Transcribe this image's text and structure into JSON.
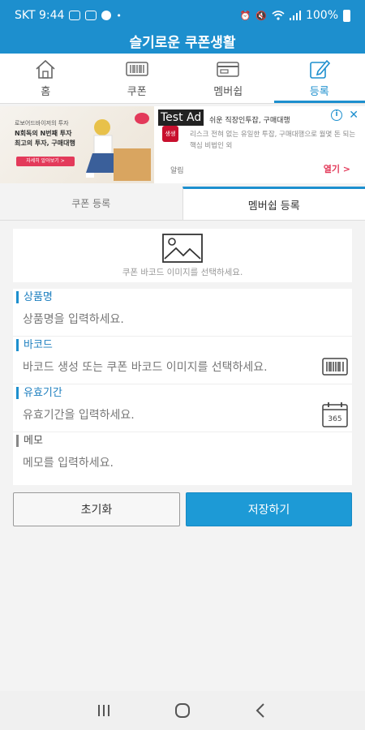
{
  "status_bar": {
    "carrier_time": "SKT 9:44",
    "battery": "100%"
  },
  "app": {
    "title": "슬기로운 쿠폰생활"
  },
  "top_tabs": [
    {
      "label": "홈",
      "icon": "home-icon"
    },
    {
      "label": "쿠폰",
      "icon": "barcode-icon"
    },
    {
      "label": "멤버쉽",
      "icon": "card-icon"
    },
    {
      "label": "등록",
      "icon": "edit-icon",
      "active": true
    }
  ],
  "ad": {
    "image_line1": "로보어드바이저의 투자",
    "image_line2": "N회독의 N번째 투자",
    "image_line3": "최고의 투자, 구매대행",
    "image_button": "자세히 알아보기 >",
    "badge": "Test Ad",
    "logo_text": "생생",
    "headline": "쉬운 직장인투잡, 구매대행",
    "description": "리스크 전혀 없는 유일한 투잡, 구매대행으로 월몇 돈 되는 핵심 비법인 외",
    "sponsor": "알림",
    "open_label": "열기 >",
    "info_glyph": "i",
    "close_glyph": "✕"
  },
  "sub_tabs": [
    {
      "label": "쿠폰 등록",
      "active": false
    },
    {
      "label": "멤버쉽 등록",
      "active": true
    }
  ],
  "image_picker": {
    "hint": "쿠폰 바코드 이미지를 선택하세요."
  },
  "form": {
    "product_name": {
      "label": "상품명",
      "placeholder": "상품명을 입력하세요.",
      "value": ""
    },
    "barcode": {
      "label": "바코드",
      "placeholder": "바코드 생성 또는 쿠폰 바코드 이미지를 선택하세요.",
      "value": ""
    },
    "expiry": {
      "label": "유효기간",
      "placeholder": "유효기간을 입력하세요.",
      "value": "",
      "calendar_text": "365"
    },
    "memo": {
      "label": "메모",
      "placeholder": "메모를 입력하세요.",
      "value": ""
    }
  },
  "buttons": {
    "reset": "초기화",
    "save": "저장하기"
  },
  "colors": {
    "accent": "#1d8fce",
    "save_button": "#1d9ad6",
    "ad_red": "#e33a5a"
  }
}
